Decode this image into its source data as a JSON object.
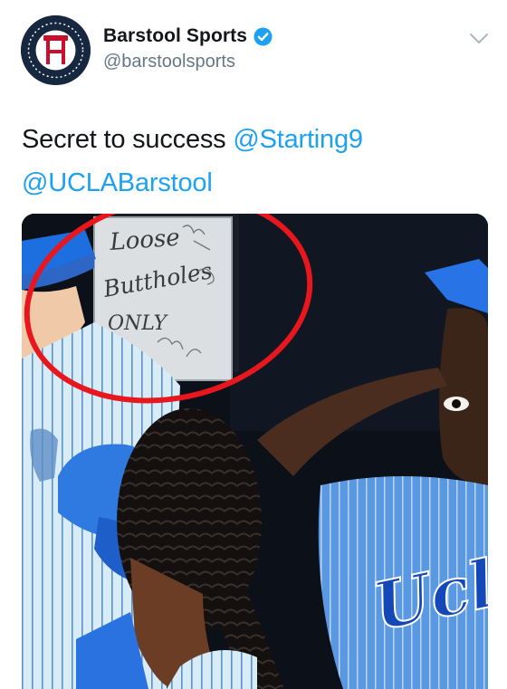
{
  "account": {
    "display_name": "Barstool Sports",
    "handle": "@barstoolsports",
    "verified": true,
    "avatar_icon": "barstool-logo-icon"
  },
  "tweet": {
    "text_prefix": "Secret to success ",
    "mentions": [
      "@Starting9",
      "@UCLABarstool"
    ]
  },
  "media": {
    "sign_lines": [
      "Loose",
      "Buttholes",
      "ONLY"
    ],
    "jersey_text": "Ucla"
  },
  "colors": {
    "link": "#1da1f2",
    "verified": "#1da1f2",
    "circle_annotation": "#e8171d",
    "secondary_text": "#657786"
  }
}
